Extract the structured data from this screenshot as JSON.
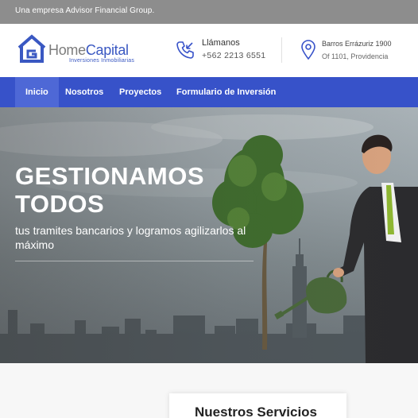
{
  "topbar": {
    "text": "Una empresa Advisor Financial Group."
  },
  "logo": {
    "word_a": "Home",
    "word_b": "Capital",
    "tagline": "Inversiones Inmobiliarias"
  },
  "contact": {
    "phone_label": "Llámanos",
    "phone_number": "+562 2213 6551",
    "address_line1": "Barros Errázuriz 1900",
    "address_line2": "Of 1101, Providencia"
  },
  "nav": {
    "items": [
      {
        "label": "Inicio"
      },
      {
        "label": "Nosotros"
      },
      {
        "label": "Proyectos"
      },
      {
        "label": "Formulario de Inversión"
      }
    ]
  },
  "hero": {
    "title_line1": "GESTIONAMOS",
    "title_line2": "TODOS",
    "subtitle": "tus tramites bancarios y logramos agilizarlos al máximo"
  },
  "services": {
    "title": "Nuestros Servicios"
  },
  "colors": {
    "brand_blue": "#3752c9",
    "topbar_gray": "#8d8d8d",
    "logo_gray": "#7c7c7c"
  },
  "icons": [
    "home-logo-icon",
    "phone-icon",
    "map-pin-icon"
  ]
}
